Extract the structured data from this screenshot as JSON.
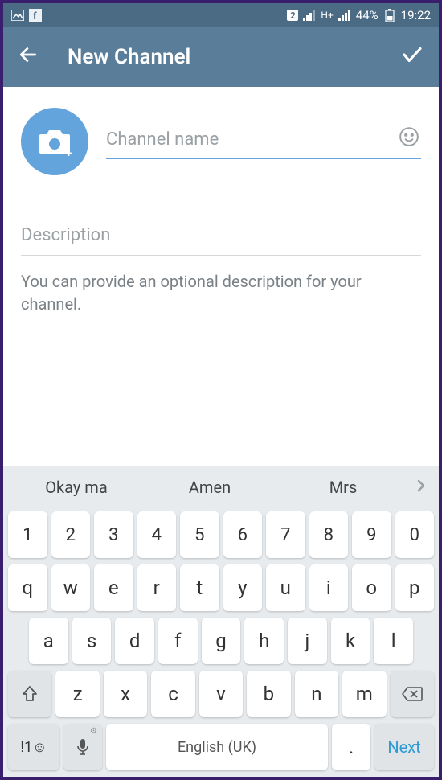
{
  "status": {
    "sim": "2",
    "net": "H+",
    "battery": "44%",
    "time": "19:22"
  },
  "app_bar": {
    "title": "New Channel"
  },
  "form": {
    "name_placeholder": "Channel name",
    "name_value": "",
    "desc_placeholder": "Description",
    "desc_value": "",
    "desc_hint": "You can provide an optional description for your channel."
  },
  "keyboard": {
    "suggestions": [
      "Okay ma",
      "Amen",
      "Mrs"
    ],
    "row_num": [
      "1",
      "2",
      "3",
      "4",
      "5",
      "6",
      "7",
      "8",
      "9",
      "0"
    ],
    "row1": [
      "q",
      "w",
      "e",
      "r",
      "t",
      "y",
      "u",
      "i",
      "o",
      "p"
    ],
    "row2": [
      "a",
      "s",
      "d",
      "f",
      "g",
      "h",
      "j",
      "k",
      "l"
    ],
    "row3": [
      "z",
      "x",
      "c",
      "v",
      "b",
      "n",
      "m"
    ],
    "sym_label": "!1☺",
    "space_label": "English (UK)",
    "dot_label": ".",
    "next_label": "Next"
  }
}
